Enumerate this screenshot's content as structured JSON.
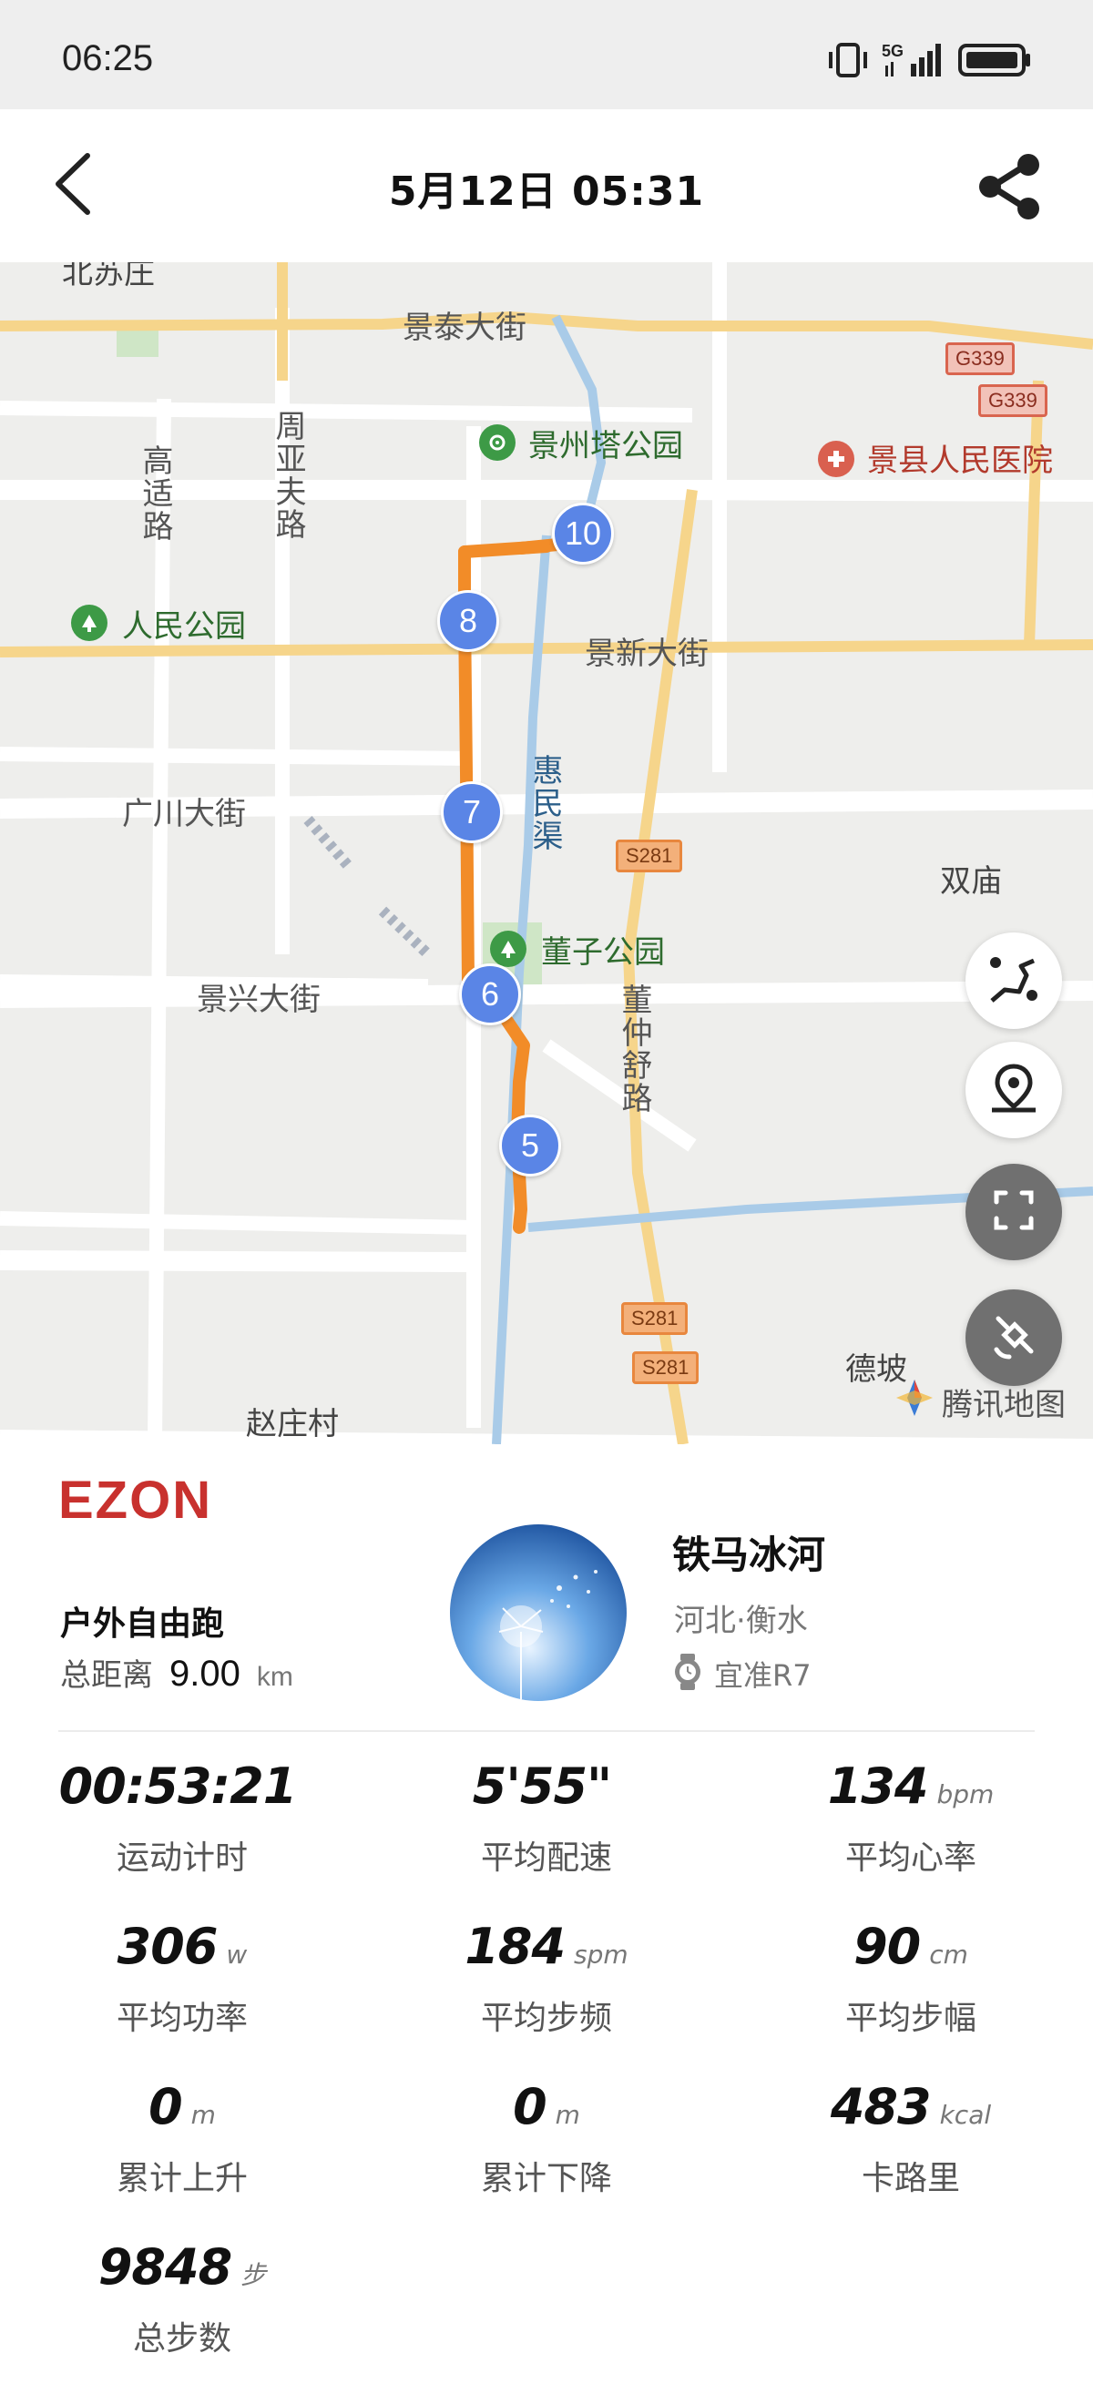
{
  "status_bar": {
    "time": "06:25",
    "icons": [
      "vibrate-icon",
      "signal-5g-icon",
      "battery-icon"
    ]
  },
  "header": {
    "title": "5月12日  05:31",
    "back_icon": "chevron-left-icon",
    "share_icon": "share-icon"
  },
  "map": {
    "labels": {
      "beisuzhuang": "北苏庄",
      "jingtai_street": "景泰大街",
      "jingzhouta_park": "景州塔公园",
      "jingxian_hospital": "景县人民医院",
      "gaoshi_road": "高适路",
      "zhouyafu_road": "周亚夫路",
      "renmin_park": "人民公园",
      "jingxin_street": "景新大街",
      "guangchuan_street": "广川大街",
      "huimin_canal": "惠民渠",
      "shuangmiao": "双庙",
      "dongzi_park": "董子公园",
      "jingxing_street": "景兴大街",
      "dongzhongshu_road": "董仲舒路",
      "depo": "德坡",
      "zhaozhuang": "赵庄村"
    },
    "road_badges": {
      "g339_a": "G339",
      "g339_b": "G339",
      "s281_a": "S281",
      "s281_b": "S281",
      "s281_c": "S281"
    },
    "km_markers": {
      "m10": "10",
      "m8": "8",
      "m7": "7",
      "m6": "6",
      "m5": "5"
    },
    "attribution": "腾讯地图",
    "route_color": "#f28c28"
  },
  "summary": {
    "brand": "EZON",
    "activity_type": "户外自由跑",
    "distance_label": "总距离",
    "distance_value": "9.00",
    "distance_unit": "km",
    "user_name": "铁马冰河",
    "user_location": "河北·衡水",
    "device_name": "宜准R7",
    "stats": [
      {
        "value": "00:53:21",
        "unit": "",
        "label": "运动计时"
      },
      {
        "value": "5'55\"",
        "unit": "",
        "label": "平均配速"
      },
      {
        "value": "134",
        "unit": "bpm",
        "label": "平均心率"
      },
      {
        "value": "306",
        "unit": "w",
        "label": "平均功率"
      },
      {
        "value": "184",
        "unit": "spm",
        "label": "平均步频"
      },
      {
        "value": "90",
        "unit": "cm",
        "label": "平均步幅"
      },
      {
        "value": "0",
        "unit": "m",
        "label": "累计上升"
      },
      {
        "value": "0",
        "unit": "m",
        "label": "累计下降"
      },
      {
        "value": "483",
        "unit": "kcal",
        "label": "卡路里"
      },
      {
        "value": "9848",
        "unit": "步",
        "label": "总步数"
      }
    ]
  },
  "colors": {
    "brand": "#c8312e",
    "marker": "#5a85e6",
    "route": "#f28c28"
  }
}
